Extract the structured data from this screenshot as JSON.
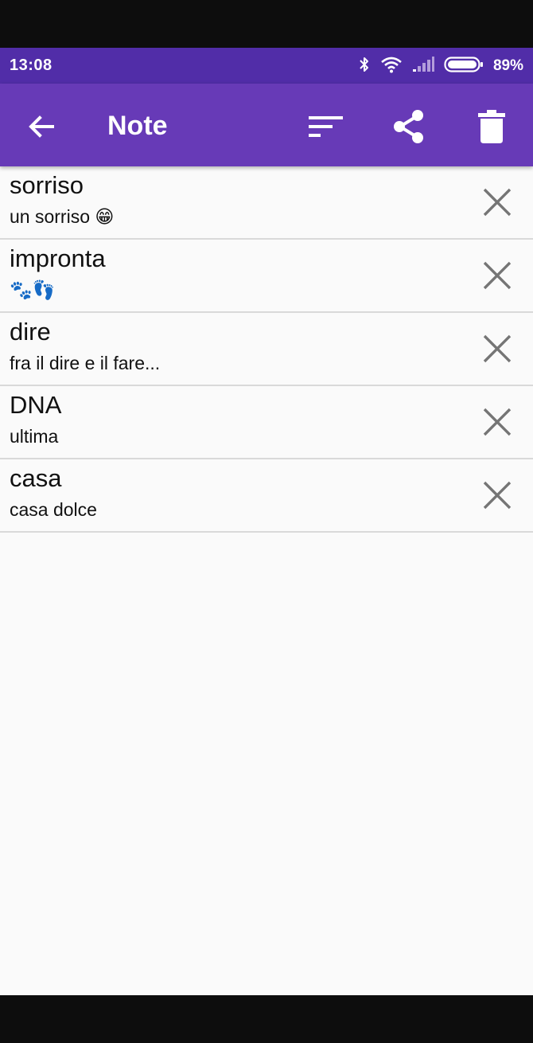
{
  "status_bar": {
    "time": "13:08",
    "battery_percent": "89%",
    "icons": [
      "bluetooth-icon",
      "wifi-icon",
      "signal-icon",
      "battery-icon"
    ]
  },
  "app_bar": {
    "title": "Note",
    "actions": [
      "back-arrow-icon",
      "sort-icon",
      "share-icon",
      "trash-icon"
    ]
  },
  "notes": [
    {
      "title": "sorriso",
      "text": "un sorriso 😁"
    },
    {
      "title": "impronta",
      "text": "🐾👣"
    },
    {
      "title": "dire",
      "text": "fra il dire e il fare..."
    },
    {
      "title": "DNA",
      "text": "ultima"
    },
    {
      "title": "casa",
      "text": "casa dolce"
    }
  ],
  "colors": {
    "status_bar": "#512da8",
    "app_bar": "#673ab7",
    "background": "#fafafa",
    "divider": "#d9d9d9",
    "delete_icon": "#757575"
  }
}
